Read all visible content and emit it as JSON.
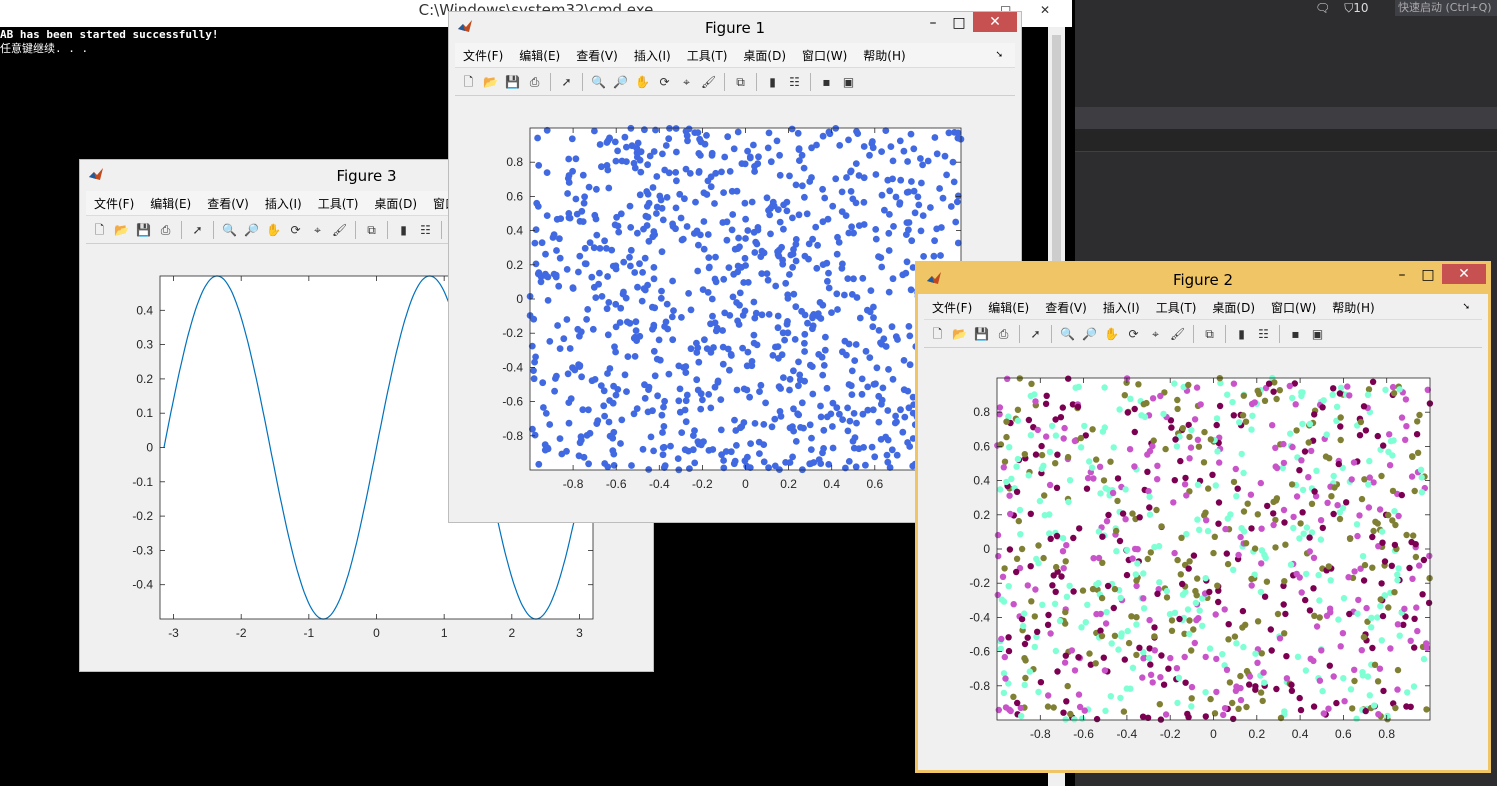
{
  "cmd": {
    "title": "C:\\Windows\\system32\\cmd.exe",
    "line1": "AB has been started successfully!",
    "line2": "任意键继续. . ."
  },
  "taskbar": {
    "notif_count": "10",
    "quick_launch": "快速启动 (Ctrl+Q)"
  },
  "menu": [
    "文件(F)",
    "编辑(E)",
    "查看(V)",
    "插入(I)",
    "工具(T)",
    "桌面(D)",
    "窗口(W)",
    "帮助(H)"
  ],
  "figure_window_controls": {
    "minimize": "–",
    "maximize": "□",
    "close": "✕"
  },
  "toolbar_icons": [
    "new-figure-icon",
    "open-icon",
    "save-icon",
    "print-icon",
    "pointer-icon",
    "zoom-in-icon",
    "zoom-out-icon",
    "pan-icon",
    "rotate-icon",
    "data-cursor-icon",
    "brush-icon",
    "link-plot-icon",
    "colorbar-icon",
    "legend-icon",
    "hide-plot-tools-icon",
    "show-plot-tools-icon"
  ],
  "colors": {
    "fig1_marker": "#4169e1",
    "sine_line": "#0072bd",
    "fig2_colors": [
      "#7b0051",
      "#c953c9",
      "#7fffd4",
      "#808034"
    ],
    "fig2_titlebar": "#f0c565"
  },
  "figures": {
    "fig1": {
      "title": "Figure 1",
      "chart_data": {
        "type": "scatter",
        "n_points": 1000,
        "distribution": "uniform random",
        "xlim": [
          -1,
          1
        ],
        "ylim": [
          -1,
          1
        ],
        "xticks": [
          -0.8,
          -0.6,
          -0.4,
          -0.2,
          0,
          0.2,
          0.4,
          0.6
        ],
        "yticks": [
          0.8,
          0.6,
          0.4,
          0.2,
          0,
          -0.2,
          -0.4,
          -0.6,
          -0.8
        ],
        "marker": "filled circle",
        "grid": false
      }
    },
    "fig2": {
      "title": "Figure 2",
      "chart_data": {
        "type": "scatter",
        "n_points": 1000,
        "distribution": "uniform random",
        "xlim": [
          -1,
          1
        ],
        "ylim": [
          -1,
          1
        ],
        "xticks": [
          -0.8,
          -0.6,
          -0.4,
          -0.2,
          0,
          0.2,
          0.4,
          0.6,
          0.8
        ],
        "yticks": [
          0.8,
          0.6,
          0.4,
          0.2,
          0,
          -0.2,
          -0.4,
          -0.6,
          -0.8
        ],
        "marker": "filled circle, random colors from palette",
        "grid": false
      }
    },
    "fig3": {
      "title": "Figure 3",
      "chart_data": {
        "type": "line",
        "function": "0.5*sin(2x)",
        "x_range": [
          -3.14159,
          3.14159
        ],
        "xlim": [
          -3.2,
          3.2
        ],
        "ylim": [
          -0.5,
          0.5
        ],
        "xticks": [
          -3,
          -2,
          -1,
          0,
          1,
          2,
          3
        ],
        "yticks": [
          0.4,
          0.3,
          0.2,
          0.1,
          0,
          -0.1,
          -0.2,
          -0.3,
          -0.4
        ],
        "grid": false
      }
    }
  }
}
